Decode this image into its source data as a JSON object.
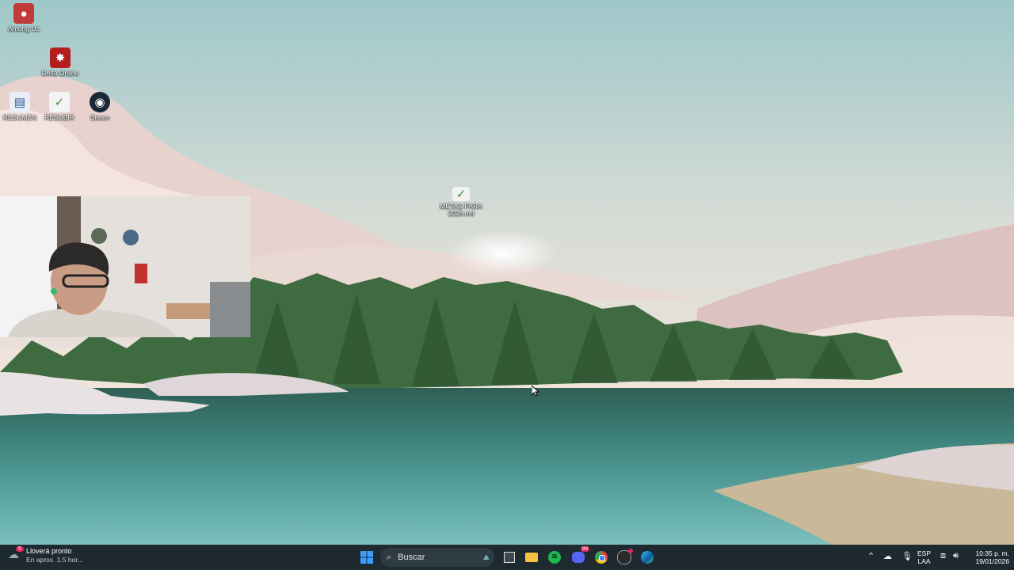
{
  "desktop": {
    "icons": [
      {
        "label": "Among Us",
        "icon": "among-us-icon"
      },
      {
        "label": "Delta Online",
        "icon": "delta-online-icon"
      },
      {
        "label": "RESUMEN",
        "icon": "document-icon"
      },
      {
        "label": "RESUBIR",
        "icon": "document-icon"
      },
      {
        "label": "Steam",
        "icon": "steam-icon"
      },
      {
        "label": "METAS PARA 2026.md",
        "icon": "markdown-file-icon"
      }
    ]
  },
  "taskbar": {
    "weather": {
      "title": "Lloverá pronto",
      "subtitle": "En aprox. 1.5 hor...",
      "badge": "5"
    },
    "search_placeholder": "Buscar",
    "apps": [
      "windows-start-icon",
      "task-view-icon",
      "file-explorer-icon",
      "spotify-icon",
      "discord-icon",
      "chrome-icon",
      "github-icon",
      "edge-icon"
    ],
    "discord_badge": "99",
    "tray": {
      "lang_top": "ESP",
      "lang_bottom": "LAA",
      "time": "10:35 p. m.",
      "date": "19/01/2026"
    }
  },
  "colors": {
    "taskbar_bg": "#1f2a30",
    "accent": "#0078d4"
  }
}
